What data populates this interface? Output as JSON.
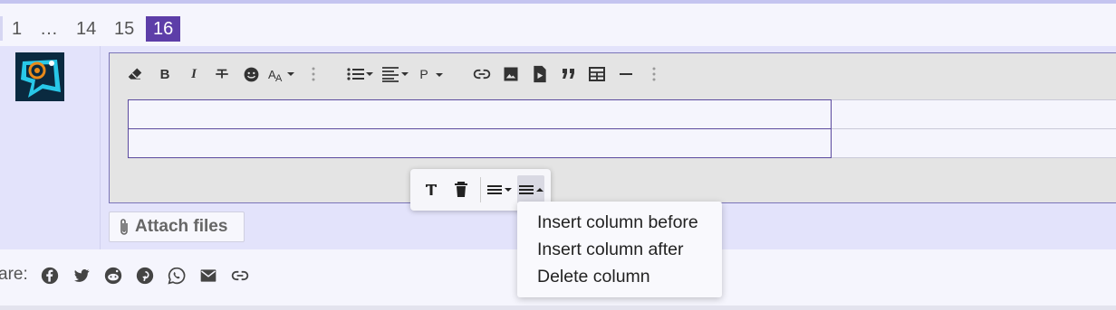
{
  "pagination": {
    "pages": [
      {
        "label": "1",
        "current": false
      },
      {
        "label": "…",
        "current": false
      },
      {
        "label": "14",
        "current": false
      },
      {
        "label": "15",
        "current": false
      },
      {
        "label": "16",
        "current": true
      }
    ]
  },
  "editor": {
    "toolbar": [
      "eraser-icon",
      "bold-icon",
      "italic-icon",
      "strikethrough-icon",
      "smile-icon",
      "font-size-icon",
      "more-vertical-icon",
      "list-icon",
      "align-icon",
      "paragraph-icon",
      "link-icon",
      "image-icon",
      "media-icon",
      "quote-icon",
      "table-icon",
      "horizontal-rule-icon",
      "more-vertical-icon"
    ],
    "paragraph_label": "P",
    "table_rows": [
      [
        "",
        ""
      ],
      [
        "",
        ""
      ]
    ]
  },
  "attach": {
    "label": "Attach files"
  },
  "share": {
    "label": "are:",
    "icons": [
      "facebook-icon",
      "twitter-icon",
      "reddit-icon",
      "pinterest-icon",
      "whatsapp-icon",
      "email-icon",
      "link-icon"
    ]
  },
  "table_popup": {
    "buttons": [
      "header-icon",
      "delete-table-icon",
      "row-menu-icon",
      "column-menu-icon"
    ]
  },
  "column_menu": {
    "items": [
      "Insert column before",
      "Insert column after",
      "Delete column"
    ]
  },
  "colors": {
    "accent": "#5d3ea8",
    "editor_border": "#7a74b8",
    "background": "#f5f5fd",
    "post_bg": "#e3e3fb"
  }
}
